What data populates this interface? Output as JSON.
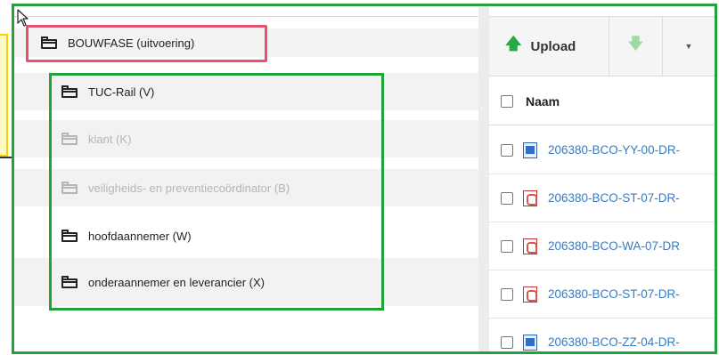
{
  "tree": {
    "root": {
      "label": "BOUWFASE (uitvoering)",
      "icon": "folder-icon"
    },
    "children": [
      {
        "label": "TUC-Rail (V)",
        "state": "enabled"
      },
      {
        "label": "klant (K)",
        "state": "disabled"
      },
      {
        "label": "veiligheids- en preventiecoördinator (B)",
        "state": "disabled"
      },
      {
        "label": "hoofdaannemer (W)",
        "state": "enabled"
      },
      {
        "label": "onderaannemer en leverancier (X)",
        "state": "enabled"
      }
    ]
  },
  "toolbar": {
    "upload_label": "Upload",
    "upload_icon": "arrow-up-icon",
    "download_icon": "arrow-down-icon",
    "more_icon": "caret-down-icon"
  },
  "files": {
    "column_name": "Naam",
    "rows": [
      {
        "name": "206380-BCO-YY-00-DR-",
        "type": "doc"
      },
      {
        "name": "206380-BCO-ST-07-DR-",
        "type": "pdf"
      },
      {
        "name": "206380-BCO-WA-07-DR",
        "type": "pdf"
      },
      {
        "name": "206380-BCO-ST-07-DR-",
        "type": "pdf"
      },
      {
        "name": "206380-BCO-ZZ-04-DR-",
        "type": "doc"
      }
    ]
  },
  "colors": {
    "highlight_red": "#e8506f",
    "highlight_green": "#21a33a",
    "callout_yellow": "#f2d600",
    "link_blue": "#3a7bbf",
    "upload_green": "#27a844"
  }
}
